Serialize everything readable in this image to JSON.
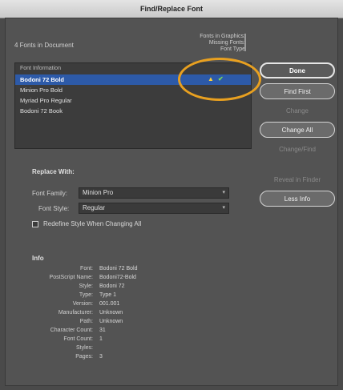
{
  "window": {
    "title": "Find/Replace Font"
  },
  "fonts_list": {
    "count_label": "4 Fonts in Document",
    "columns_header": [
      "Fonts in Graphics:",
      "Missing Fonts:",
      "Font Type"
    ],
    "list_header": "Font Information",
    "items": [
      {
        "label": "Bodoni 72 Bold",
        "selected": true
      },
      {
        "label": "Minion Pro Bold",
        "selected": false
      },
      {
        "label": "Myriad Pro Regular",
        "selected": false
      },
      {
        "label": "Bodoni 72 Book",
        "selected": false
      }
    ]
  },
  "buttons": {
    "done": "Done",
    "find_first": "Find First",
    "change": "Change",
    "change_all": "Change All",
    "change_find": "Change/Find",
    "reveal_in_finder": "Reveal in Finder",
    "less_info": "Less Info"
  },
  "replace_with": {
    "label": "Replace With:",
    "font_family_label": "Font Family:",
    "font_family_value": "Minion Pro",
    "font_style_label": "Font Style:",
    "font_style_value": "Regular",
    "checkbox_label": "Redefine Style When Changing All"
  },
  "info": {
    "title": "Info",
    "rows": [
      {
        "label": "Font:",
        "value": "Bodoni 72 Bold"
      },
      {
        "label": "PostScript Name:",
        "value": "Bodoni72-Bold"
      },
      {
        "label": "Style:",
        "value": "Bodoni 72"
      },
      {
        "label": "Type:",
        "value": "Type 1"
      },
      {
        "label": "Version:",
        "value": "001.001"
      },
      {
        "label": "Manufacturer:",
        "value": "Unknown"
      },
      {
        "label": "Path:",
        "value": "Unknown"
      },
      {
        "label": "Character Count:",
        "value": "31"
      },
      {
        "label": "Font Count:",
        "value": "1"
      },
      {
        "label": "Styles:",
        "value": ""
      },
      {
        "label": "Pages:",
        "value": "3"
      }
    ]
  }
}
